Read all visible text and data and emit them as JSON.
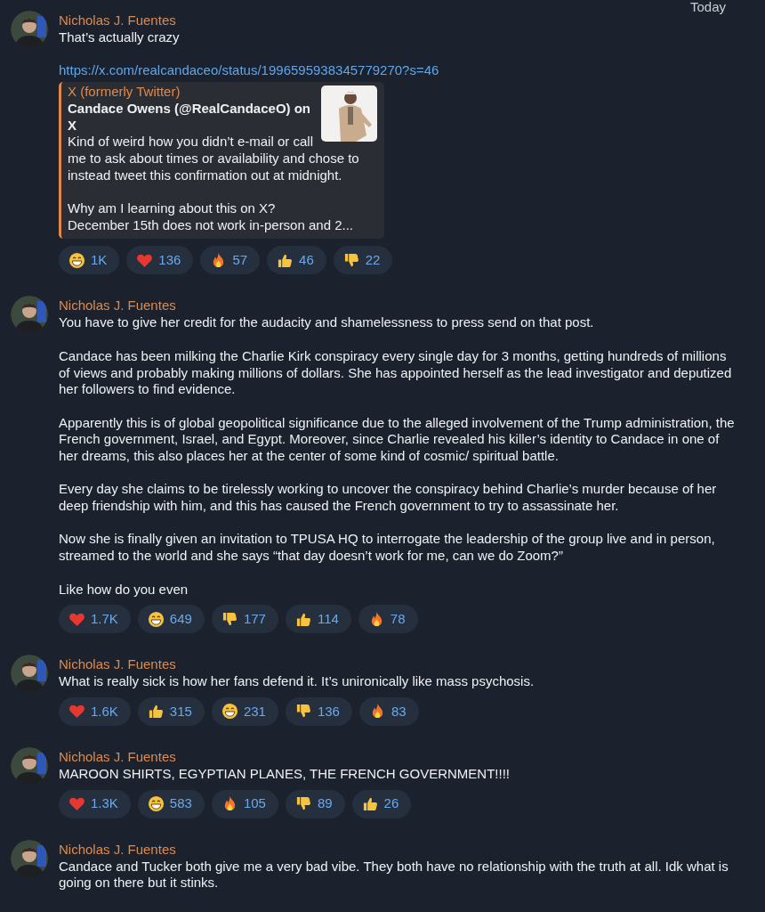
{
  "date_label": "Today",
  "messages": [
    {
      "sender": "Nicholas J. Fuentes",
      "paragraphs": [
        "That’s actually crazy"
      ],
      "link": "https://x.com/realcandaceo/status/1996595938345779270?s=46",
      "preview": {
        "site": "X (formerly Twitter)",
        "title": "Candace Owens (@RealCandaceO) on X",
        "paragraphs": [
          "Kind of weird how you didn’t e-mail or call me to ask about times or availability and chose to instead tweet this confirmation out at midnight.",
          "Why am I learning about this on X?\nDecember 15th does not work in-person and 2..."
        ]
      },
      "reactions": [
        {
          "kind": "grin",
          "count": "1K"
        },
        {
          "kind": "heart",
          "count": "136"
        },
        {
          "kind": "fire",
          "count": "57"
        },
        {
          "kind": "thumbs_up",
          "count": "46"
        },
        {
          "kind": "thumbs_down",
          "count": "22"
        }
      ]
    },
    {
      "sender": "Nicholas J. Fuentes",
      "paragraphs": [
        "You have to give her credit for the audacity and shamelessness to press send on that post.",
        "Candace has been milking the Charlie Kirk conspiracy every single day for 3 months, getting hundreds of millions of views and probably making millions of dollars. She has appointed herself as the lead investigator and deputized her followers to find evidence.",
        "Apparently this is of global geopolitical significance due to the alleged involvement of the Trump administration, the French government, Israel, and Egypt. Moreover, since Charlie revealed his killer’s identity to Candace in one of her dreams, this also places her at the center of some kind of cosmic/ spiritual battle.",
        "Every day she claims to be tirelessly working to uncover the conspiracy behind Charlie’s murder because of her deep friendship with him, and this has caused the French government to try to assassinate her.",
        "Now she is finally given an invitation to TPUSA HQ to interrogate the leadership of the group live and in person, streamed to the world and she says “that day doesn’t work for me, can we do Zoom?”",
        "Like how do you even"
      ],
      "reactions": [
        {
          "kind": "heart",
          "count": "1.7K"
        },
        {
          "kind": "grin",
          "count": "649"
        },
        {
          "kind": "thumbs_down",
          "count": "177"
        },
        {
          "kind": "thumbs_up",
          "count": "114"
        },
        {
          "kind": "fire",
          "count": "78"
        }
      ]
    },
    {
      "sender": "Nicholas J. Fuentes",
      "paragraphs": [
        "What is really sick is how her fans defend it. It’s unironically like mass psychosis."
      ],
      "reactions": [
        {
          "kind": "heart",
          "count": "1.6K"
        },
        {
          "kind": "thumbs_up",
          "count": "315"
        },
        {
          "kind": "grin",
          "count": "231"
        },
        {
          "kind": "thumbs_down",
          "count": "136"
        },
        {
          "kind": "fire",
          "count": "83"
        }
      ]
    },
    {
      "sender": "Nicholas J. Fuentes",
      "paragraphs": [
        "MAROON SHIRTS, EGYPTIAN PLANES, THE FRENCH GOVERNMENT!!!!"
      ],
      "reactions": [
        {
          "kind": "heart",
          "count": "1.3K"
        },
        {
          "kind": "grin",
          "count": "583"
        },
        {
          "kind": "fire",
          "count": "105"
        },
        {
          "kind": "thumbs_down",
          "count": "89"
        },
        {
          "kind": "thumbs_up",
          "count": "26"
        }
      ]
    },
    {
      "sender": "Nicholas J. Fuentes",
      "paragraphs": [
        "Candace and Tucker both give me a very bad vibe. They both have no relationship with the truth at all. Idk what is going on there but it stinks."
      ]
    }
  ]
}
